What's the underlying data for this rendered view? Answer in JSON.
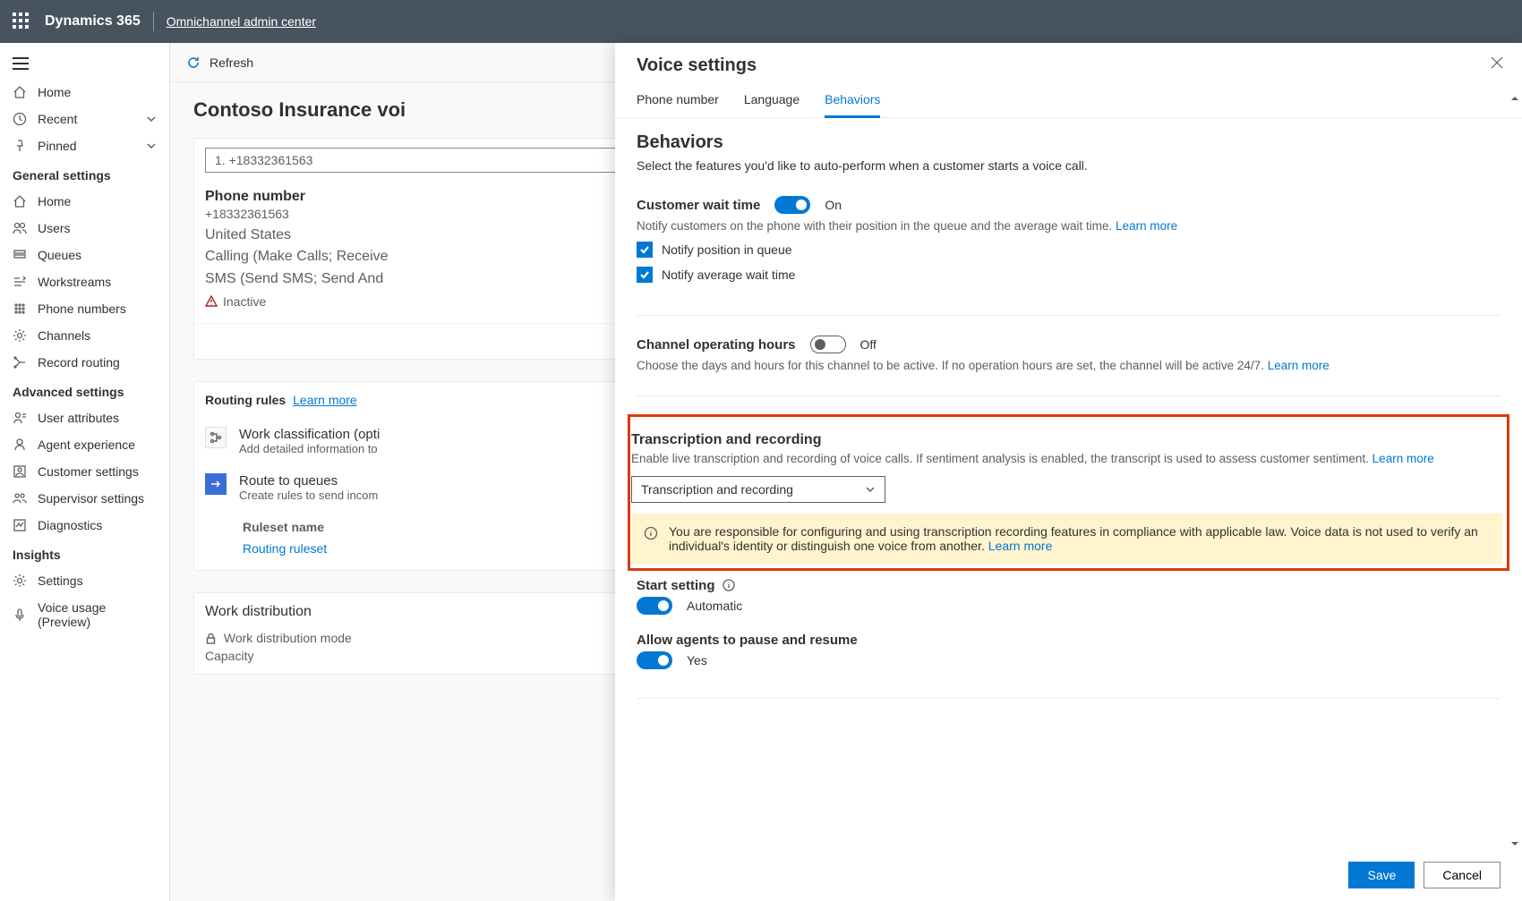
{
  "topbar": {
    "app": "Dynamics 365",
    "sub": "Omnichannel admin center"
  },
  "leftnav": {
    "home": "Home",
    "recent": "Recent",
    "pinned": "Pinned",
    "section_general": "General settings",
    "g_home": "Home",
    "g_users": "Users",
    "g_queues": "Queues",
    "g_workstreams": "Workstreams",
    "g_phone": "Phone numbers",
    "g_channels": "Channels",
    "g_routing": "Record routing",
    "section_advanced": "Advanced settings",
    "a_userattr": "User attributes",
    "a_agentexp": "Agent experience",
    "a_custset": "Customer settings",
    "a_supervisor": "Supervisor settings",
    "a_diag": "Diagnostics",
    "section_insights": "Insights",
    "i_settings": "Settings",
    "i_voice": "Voice usage (Preview)"
  },
  "cmdbar": {
    "refresh": "Refresh"
  },
  "mid": {
    "title": "Contoso Insurance voi",
    "phone_input": "1. +18332361563",
    "phone_label": "Phone number",
    "phone_number": "+18332361563",
    "country": "United States",
    "calling": "Calling (Make Calls; Receive",
    "sms": "SMS (Send SMS; Send And",
    "inactive": "Inactive",
    "routing_header": "Routing rules",
    "routing_learn": "Learn more",
    "wc_title": "Work classification (opti",
    "wc_sub": "Add detailed information to",
    "rtq_title": "Route to queues",
    "rtq_sub": "Create rules to send incom",
    "col_ruleset": "Ruleset name",
    "ruleset_link": "Routing ruleset",
    "wd_header": "Work distribution",
    "wd_mode": "Work distribution mode",
    "wd_capacity": "Capacity"
  },
  "flyout": {
    "title": "Voice settings",
    "tabs": {
      "phone": "Phone number",
      "lang": "Language",
      "behaviors": "Behaviors"
    },
    "behaviors": {
      "heading": "Behaviors",
      "desc": "Select the features you'd like to auto-perform when a customer starts a voice call.",
      "cwt_label": "Customer wait time",
      "cwt_state": "On",
      "cwt_help": "Notify customers on the phone with their position in the queue and the average wait time.",
      "learn_more": "Learn more",
      "chk_position": "Notify position in queue",
      "chk_avg": "Notify average wait time",
      "coh_label": "Channel operating hours",
      "coh_state": "Off",
      "coh_help": "Choose the days and hours for this channel to be active. If no operation hours are set, the channel will be active 24/7.",
      "tr_heading": "Transcription and recording",
      "tr_help": "Enable live transcription and recording of voice calls. If sentiment analysis is enabled, the transcript is used to assess customer sentiment.",
      "tr_dropdown": "Transcription and recording",
      "tr_banner": "You are responsible for configuring and using transcription recording features in compliance with applicable law. Voice data is not used to verify an individual's identity or distinguish one voice from another.",
      "start_label": "Start setting",
      "start_state": "Automatic",
      "pause_label": "Allow agents to pause and resume",
      "pause_state": "Yes"
    },
    "save": "Save",
    "cancel": "Cancel"
  }
}
